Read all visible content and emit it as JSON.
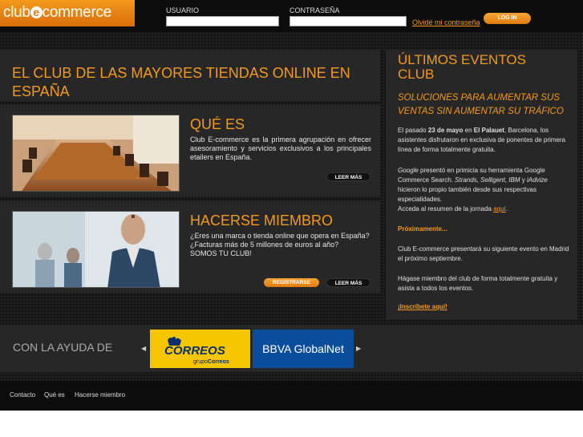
{
  "header": {
    "logo_left": "club",
    "logo_e": "e",
    "logo_right": "commerce",
    "user_label": "USUARIO",
    "user_value": "",
    "pass_label": "CONTRASEÑA",
    "pass_value": "",
    "forgot_link": "Olvidé mi contraseña",
    "login_button": "LOG IN"
  },
  "main": {
    "title": "EL CLUB DE LAS MAYORES TIENDAS ONLINE EN ESPAÑA",
    "cards": [
      {
        "title": "QUÉ ES",
        "text": "Club E-commerce es la primera agrupación en ofrecer asesoramiento y servicios exclusivos a los principales etailers en España.",
        "more_button": "LEER MÁS"
      },
      {
        "title": "HACERSE MIEMBRO",
        "text_lines": [
          "¿Eres una marca o tienda online que opera en España?",
          "¿Facturas más de 5 millones de euros al año?",
          "SOMOS TU CLUB!"
        ],
        "register_button": "REGISTRARSE",
        "more_button": "LEER MÁS"
      }
    ]
  },
  "events": {
    "title": "ÚLTIMOS EVENTOS CLUB",
    "subtitle": "SOLUCIONES PARA AUMENTAR SUS VENTAS SIN AUMENTAR SU TRÁFICO",
    "p1_a": "El pasado ",
    "p1_date": "23 de mayo",
    "p1_b": " en ",
    "p1_place": "El Palauet",
    "p1_c": ", Barcelona, los asistentes disfrutaron en exclusiva de ponentes de primera línea de forma totalmente gratuita.",
    "p2_google": "Google",
    "p2_a": " presentó en primicia su herramienta Google Commerce Search. ",
    "p2_brands": "Strands, Selligent, IBM",
    "p2_y": " y ",
    "p2_iadvize": "iAdvize",
    "p2_b": " hicieron lo propio también desde sus respectivas especialidades.",
    "p2_c": "Acceda al resumen de la jornada ",
    "p2_link": "aquí",
    "p2_dot": ".",
    "proximamente": "Próximamente...",
    "p3": "Club E-commerce presentará su siguiente evento en Madrid el próximo septiembre.",
    "p4": "Hágase miembro del club de forma totalmente gratuita y asista a todos los eventos.",
    "cta": "¡Inscríbete aquí!"
  },
  "sponsors": {
    "label": "CON LA AYUDA DE",
    "prev_icon": "chevron-left-icon",
    "next_icon": "chevron-right-icon",
    "correos_name": "CORREOS",
    "correos_group_a": "grupo",
    "correos_group_b": "Correos",
    "bbva_name": "BBVA GlobalNet"
  },
  "footer": {
    "links": [
      "Contacto",
      "Qué es",
      "Hacerse miembro"
    ]
  },
  "colors": {
    "accent": "#f39a1c",
    "background": "#161616",
    "panel": "#272727",
    "correos_yellow": "#f6c600",
    "bbva_blue": "#0b4f9c"
  }
}
